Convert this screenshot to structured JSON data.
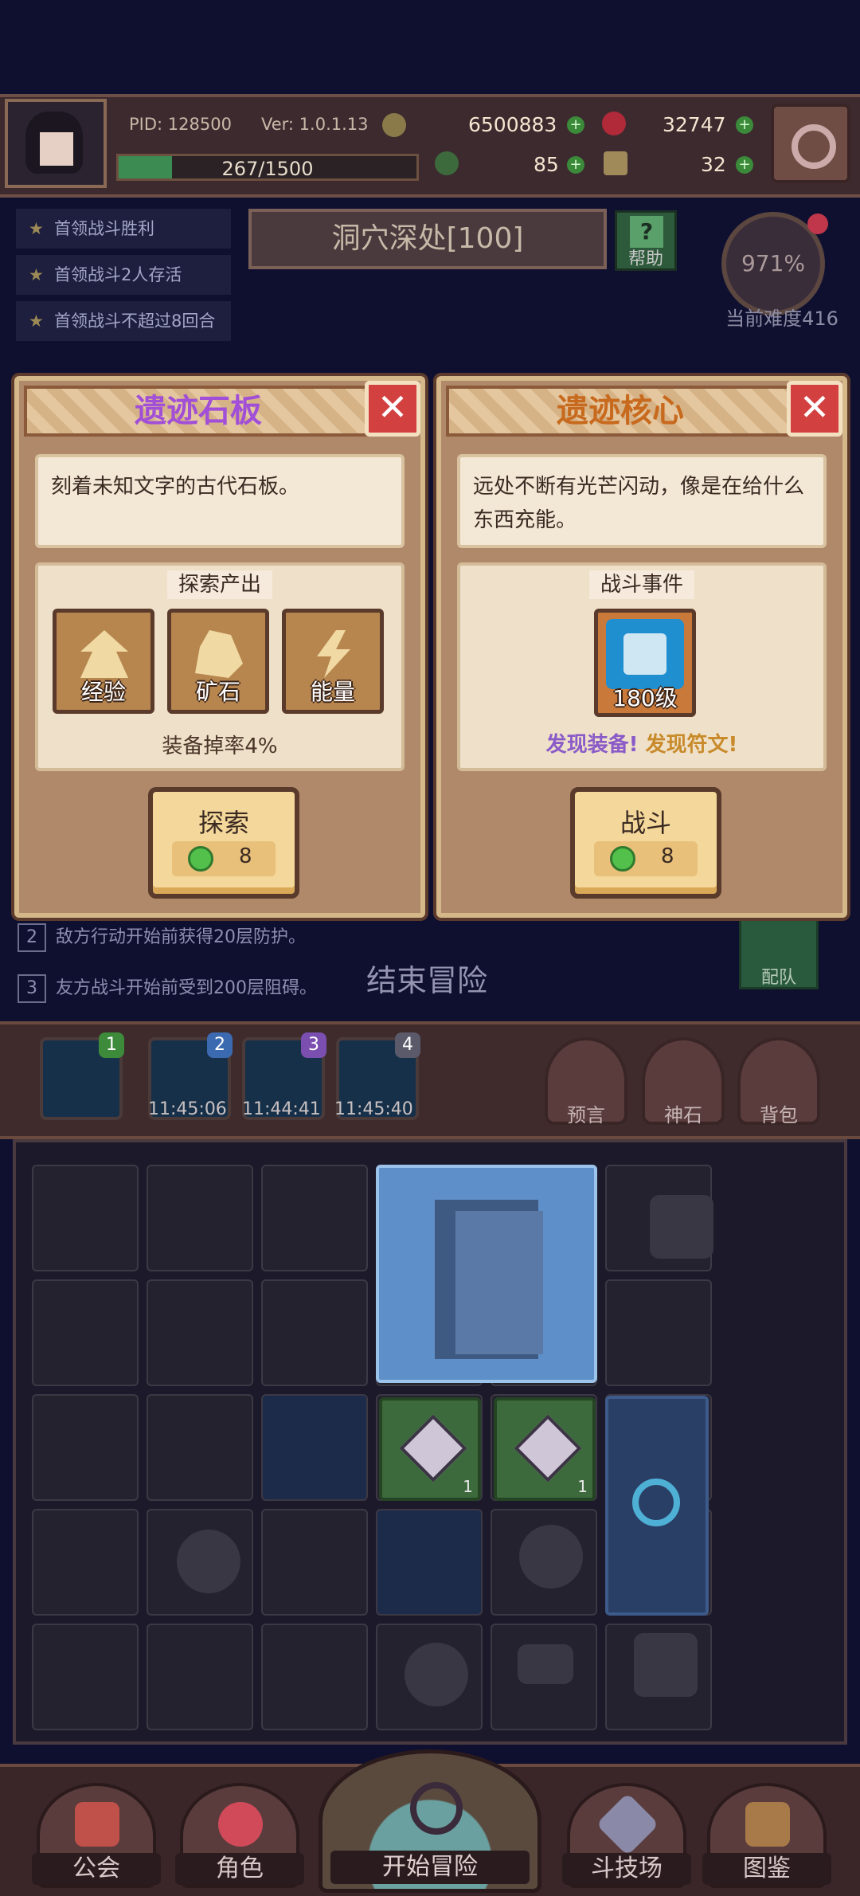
{
  "hud": {
    "pid": "PID: 128500",
    "version": "Ver: 1.0.1.13",
    "gold": "6500883",
    "gems": "32747",
    "xp": "267/1500",
    "xp_fraction": 0.18,
    "clover": "85",
    "tool": "32"
  },
  "quests": [
    "首领战斗胜利",
    "首领战斗2人存活",
    "首领战斗不超过8回合"
  ],
  "location": {
    "title": "洞穴深处[100]",
    "help": "帮助",
    "difficulty_pct": "971%",
    "difficulty_label": "当前难度416"
  },
  "panel_left": {
    "title": "遗迹石板",
    "title_color": "#a14fd6",
    "close": "✕",
    "desc": "刻着未知文字的古代石板。",
    "section": "探索产出",
    "outputs": [
      "经验",
      "矿石",
      "能量"
    ],
    "drop": "装备掉率4%",
    "button": "探索",
    "cost": "8"
  },
  "panel_right": {
    "title": "遗迹核心",
    "title_color": "#c86a1e",
    "close": "✕",
    "desc": "远处不断有光芒闪动，像是在给什么东西充能。",
    "section": "战斗事件",
    "enemy_level": "180级",
    "discover_a": "发现装备!",
    "discover_b": "发现符文!",
    "discover_a_color": "#8a5bc8",
    "discover_b_color": "#c88a2a",
    "button": "战斗",
    "cost": "8"
  },
  "rules": [
    {
      "num": "2",
      "text": "敌方行动开始前获得20层防护。"
    },
    {
      "num": "3",
      "text": "友方战斗开始前受到200层阻碍。"
    }
  ],
  "end_adventure": "结束冒险",
  "team": "配队",
  "slots": [
    {
      "badge": "1",
      "time": "",
      "badge_color": "#3d8a3a"
    },
    {
      "badge": "2",
      "time": "11:45:06",
      "badge_color": "#3c6ab0"
    },
    {
      "badge": "3",
      "time": "11:44:41",
      "badge_color": "#7a4fb0"
    },
    {
      "badge": "4",
      "time": "11:45:40",
      "badge_color": "#5a5a6a"
    }
  ],
  "side_buttons": [
    "预言",
    "神石",
    "背包"
  ],
  "grid": {
    "ore_count_a": "1",
    "ore_count_b": "1"
  },
  "nav": {
    "guild": "公会",
    "character": "角色",
    "start": "开始冒险",
    "arena": "斗技场",
    "codex": "图鉴"
  }
}
